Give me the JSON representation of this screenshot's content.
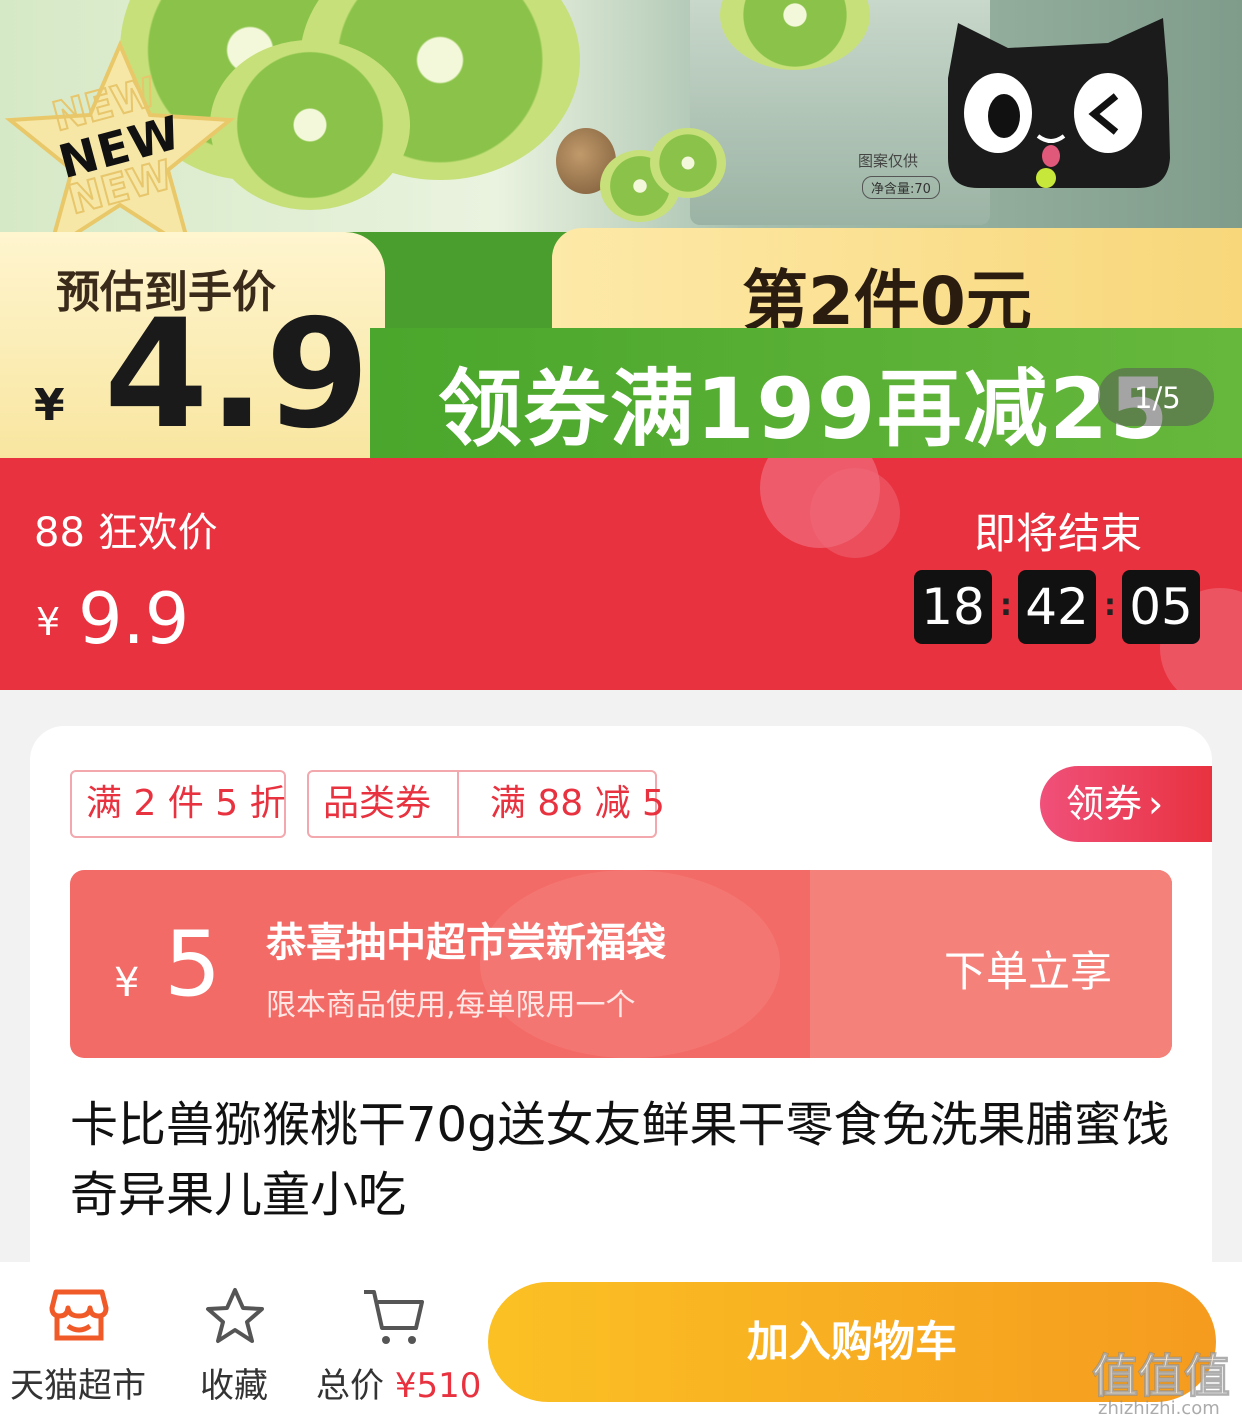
{
  "banner": {
    "new_badge": "NEW",
    "package_text": "图案仅供",
    "package_weight": "净含量:70",
    "estimated_label": "预估到手价",
    "currency": "¥",
    "estimated_price": "4.9",
    "second_item": "第2件0元",
    "coupon_offer": "领券满199再减25",
    "page_indicator": "1/5"
  },
  "promo": {
    "label": "88 狂欢价",
    "currency": "¥",
    "price": "9.9",
    "ending_label": "即将结束",
    "countdown": {
      "hours": "18",
      "minutes": "42",
      "seconds": "05"
    }
  },
  "tags": {
    "tag1": "满 2 件 5 折",
    "tag2": "品类券",
    "tag3": "满 88 减 5",
    "get_coupon": "领券"
  },
  "lucky_bag": {
    "currency": "¥",
    "amount": "5",
    "title": "恭喜抽中超市尝新福袋",
    "subtitle": "限本商品使用,每单限用一个",
    "cta": "下单立享"
  },
  "product": {
    "title": "卡比兽猕猴桃干70g送女友鲜果干零食免洗果脯蜜饯奇异果儿童小吃"
  },
  "bottom_bar": {
    "store_label": "天猫超市",
    "favorite_label": "收藏",
    "total_label": "总价",
    "total_price": "¥510",
    "add_to_cart": "加入购物车"
  },
  "watermark": {
    "brand": "值值值",
    "url": "zhizhizhi.com"
  },
  "colors": {
    "promo_red": "#e8323f",
    "green": "#4aa62c",
    "cart_orange": "#f59b1f",
    "lucky_coral": "#f36b67"
  }
}
